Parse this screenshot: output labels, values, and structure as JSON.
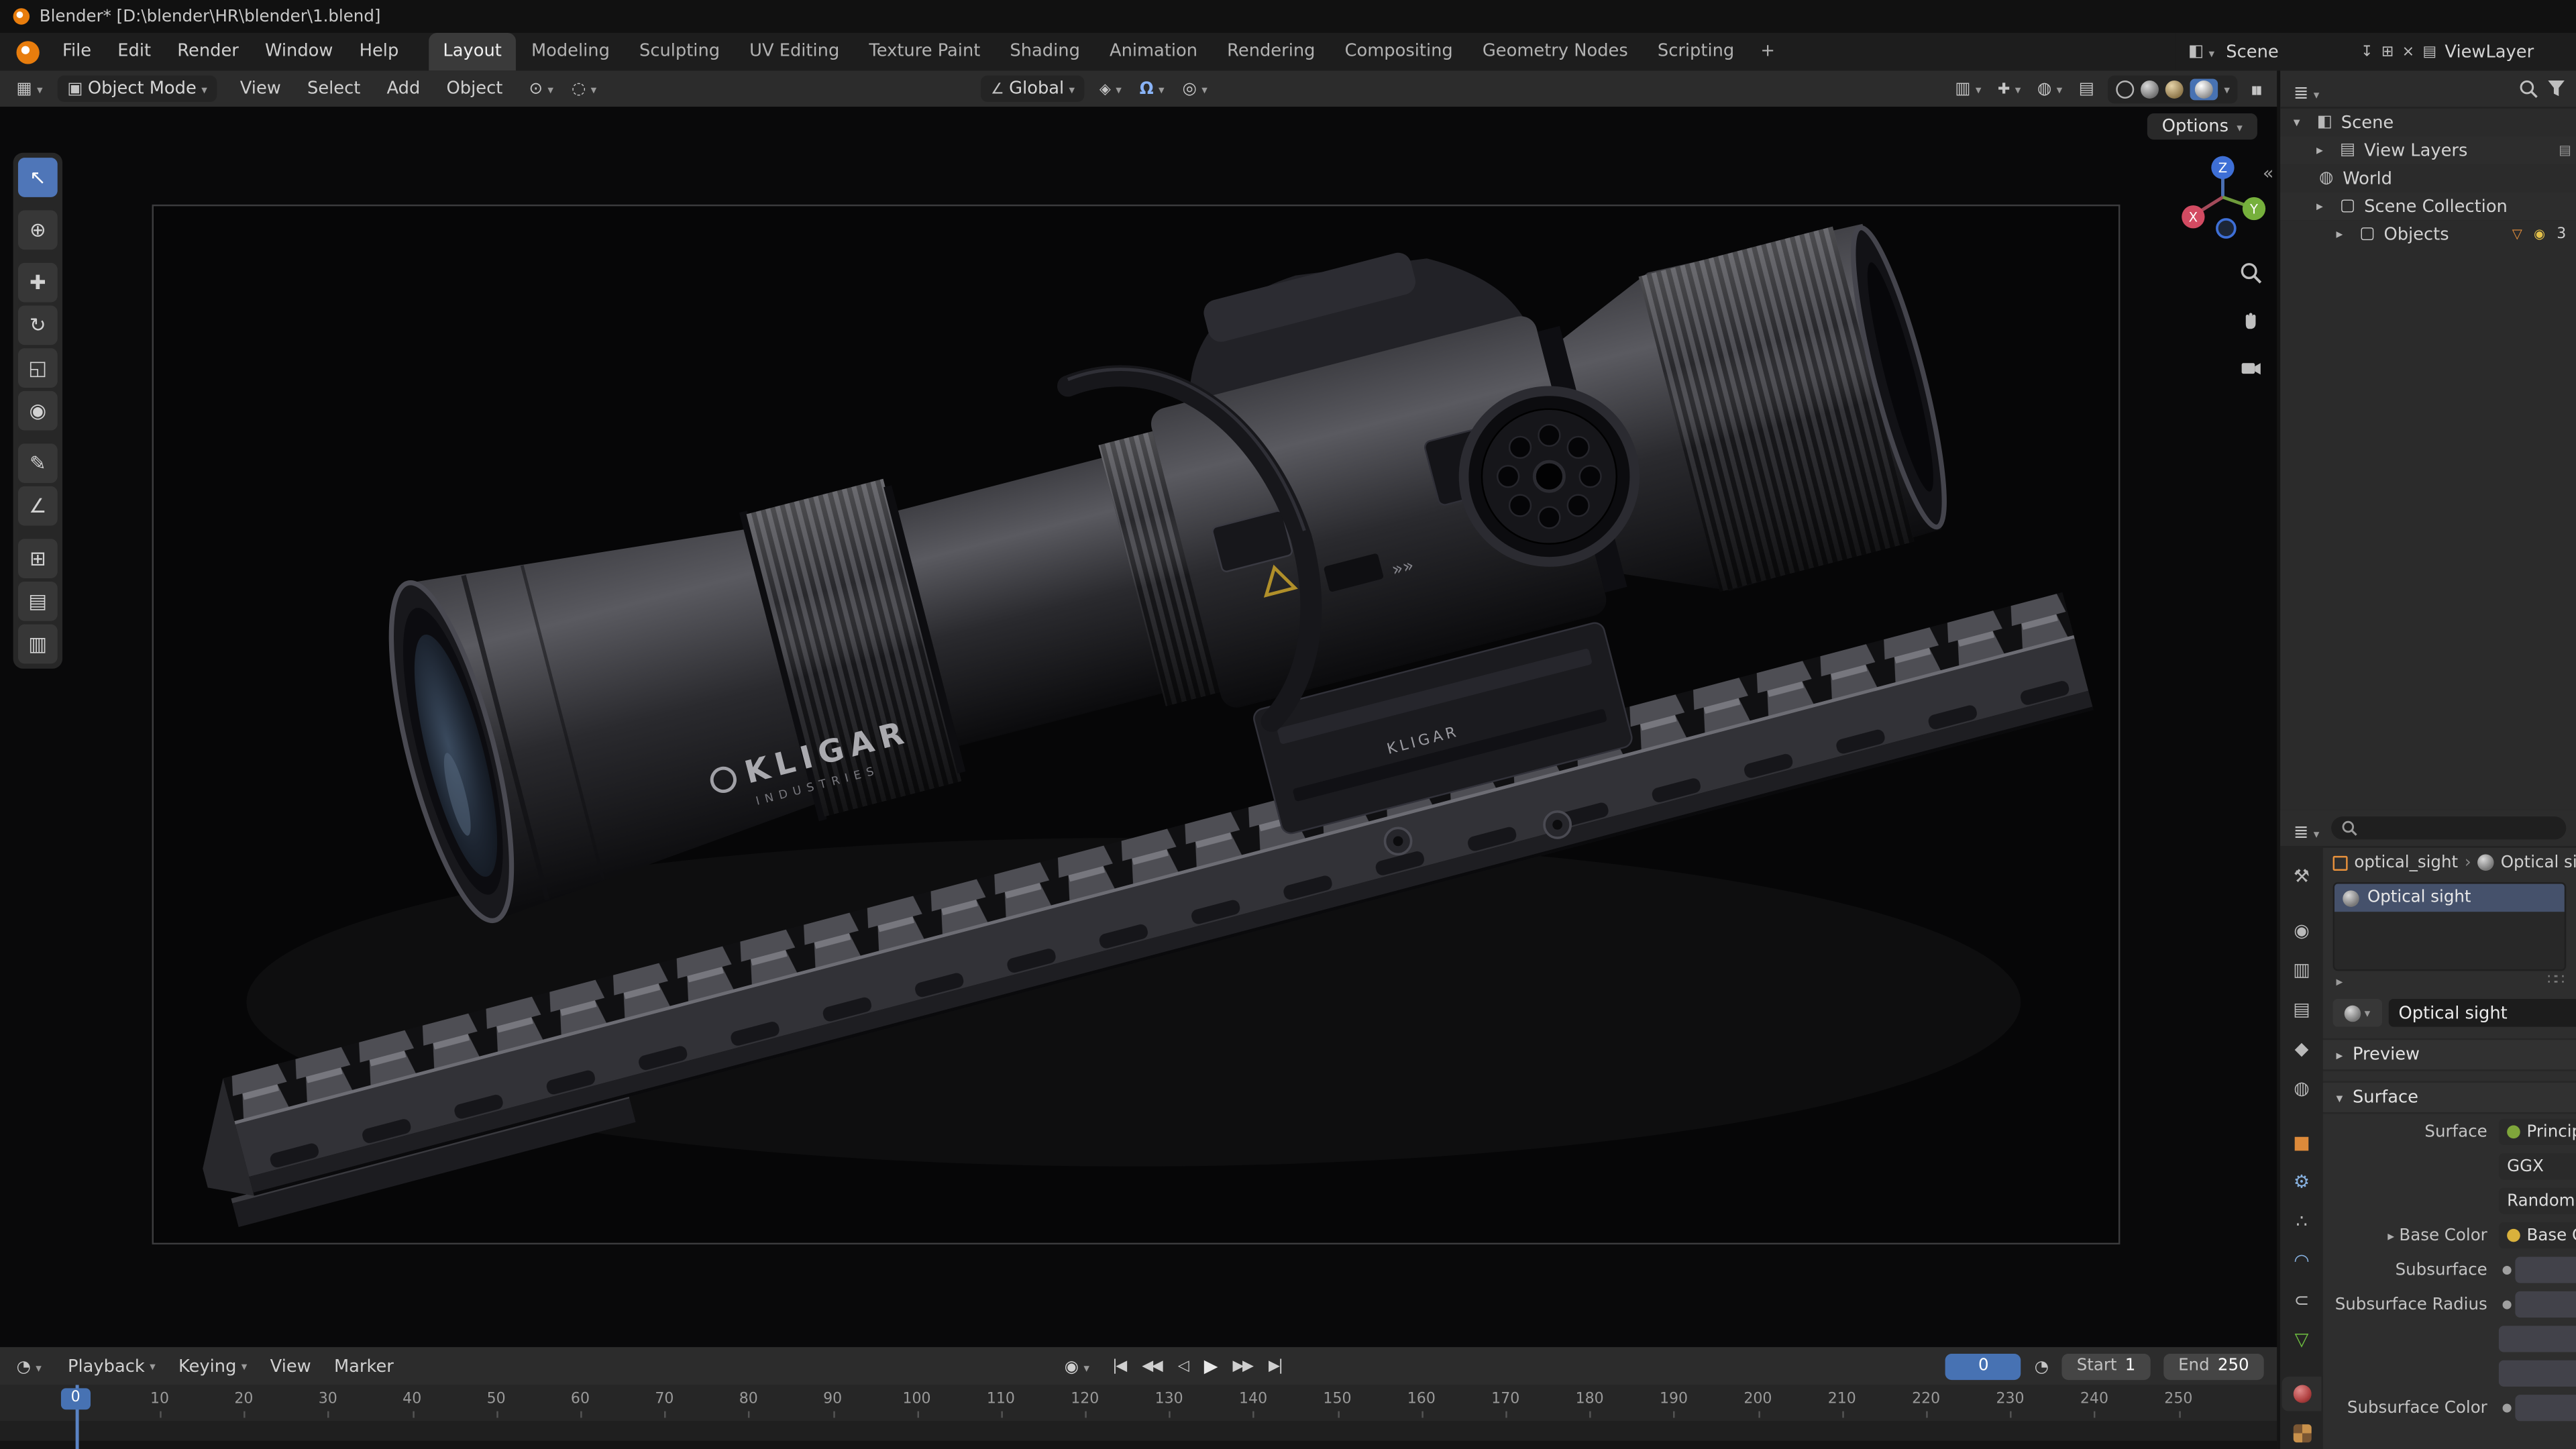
{
  "window": {
    "title": "Blender* [D:\\blender\\HR\\blender\\1.blend]"
  },
  "menubar": {
    "app_menus": [
      {
        "label": "File"
      },
      {
        "label": "Edit"
      },
      {
        "label": "Render"
      },
      {
        "label": "Window"
      },
      {
        "label": "Help"
      }
    ],
    "workspaces": [
      {
        "label": "Layout",
        "state": "active"
      },
      {
        "label": "Modeling"
      },
      {
        "label": "Sculpting"
      },
      {
        "label": "UV Editing"
      },
      {
        "label": "Texture Paint"
      },
      {
        "label": "Shading"
      },
      {
        "label": "Animation"
      },
      {
        "label": "Rendering"
      },
      {
        "label": "Compositing"
      },
      {
        "label": "Geometry Nodes"
      },
      {
        "label": "Scripting"
      }
    ],
    "add_workspace_label": "+",
    "scene_name": "Scene",
    "view_layer_name": "ViewLayer"
  },
  "viewport": {
    "header": {
      "mode": "Object Mode",
      "menus": [
        {
          "label": "View"
        },
        {
          "label": "Select"
        },
        {
          "label": "Add"
        },
        {
          "label": "Object"
        }
      ],
      "orientation": "Global",
      "options_label": "Options",
      "collapse_arrow": "«"
    },
    "toolbar": [
      {
        "dn": "tool-select-box",
        "glyph": "↖",
        "state": "active"
      },
      {
        "dn": "tool-cursor",
        "glyph": "⊕",
        "state": "gap"
      },
      {
        "dn": "tool-move",
        "glyph": "✚",
        "state": "gap"
      },
      {
        "dn": "tool-rotate",
        "glyph": "↻"
      },
      {
        "dn": "tool-scale",
        "glyph": "◱"
      },
      {
        "dn": "tool-transform",
        "glyph": "◉"
      },
      {
        "dn": "tool-annotate",
        "glyph": "✎",
        "state": "gap"
      },
      {
        "dn": "tool-measure",
        "glyph": "∠"
      },
      {
        "dn": "tool-add-cube",
        "glyph": "⊞",
        "state": "gap"
      },
      {
        "dn": "tool-extra-a",
        "glyph": "▤"
      },
      {
        "dn": "tool-extra-b",
        "glyph": "▥"
      }
    ],
    "model": {
      "brand": "KLIGAR",
      "brand_sub": "INDUSTRIES",
      "markings": "»»"
    }
  },
  "nav_gizmo": {
    "axes": [
      {
        "label": "Z",
        "color": "#3e6fd6"
      },
      {
        "label": "X",
        "color": "#d24b62"
      },
      {
        "label": "Y",
        "color": "#76b03c"
      }
    ]
  },
  "outliner": {
    "rows": [
      {
        "arrow": "▾",
        "icon_class": "ic-scene",
        "icon_name": "scene-icon",
        "label": "Scene",
        "ind": "ind0"
      },
      {
        "arrow": "▸",
        "icon_class": "ic-viewlayers",
        "icon_name": "view-layers-icon",
        "label": "View Layers",
        "ind": "ind1",
        "b0": "▤"
      },
      {
        "icon_class": "ic-world",
        "icon_name": "world-icon",
        "label": "World",
        "ind": "ind1"
      },
      {
        "arrow": "▸",
        "icon_class": "ic-collection",
        "icon_name": "collection-icon",
        "label": "Scene Collection",
        "ind": "ind1"
      },
      {
        "arrow": "▸",
        "icon_class": "ic-collection",
        "icon_name": "collection-icon",
        "label": "Objects",
        "ind": "ind2",
        "b1": "▽",
        "b2": "◉",
        "count": "3"
      }
    ]
  },
  "properties": {
    "breadcrumb": {
      "object_name": "optical_sight",
      "separator": "›",
      "material_name": "Optical sight"
    },
    "slots": [
      {
        "label": "Optical sight",
        "state": "selected"
      }
    ],
    "specials_arrow": "▸",
    "grip": "∷∷",
    "datablock_name": "Optical sight",
    "panels": {
      "preview": {
        "arrow": "▸",
        "label": "Preview"
      },
      "surface": {
        "arrow": "▾",
        "label": "Surface"
      }
    },
    "rows": [
      {
        "label": "Surface",
        "kind": "menu",
        "icon_style": "background:#7fa63b",
        "text": "Principled BSDF"
      },
      {
        "kind": "menu",
        "text": "GGX"
      },
      {
        "kind": "menu",
        "text": "Random Walk"
      },
      {
        "label": "Base Color",
        "arrow": "▸",
        "kind": "menu",
        "icon_style": "background:#d9b13c",
        "text": "Base Color"
      },
      {
        "label": "Subsurface",
        "kind": "value",
        "dot": "●"
      },
      {
        "label": "Subsurface Radius",
        "kind": "value",
        "dot": "●"
      },
      {
        "kind": "value"
      },
      {
        "kind": "value"
      },
      {
        "label": "Subsurface Color",
        "kind": "value",
        "dot": "●"
      }
    ],
    "tabs": [
      {
        "dn": "properties-tab-tool",
        "glyph": "⚒"
      },
      {
        "dn": "properties-tab-render",
        "glyph": "◉",
        "state": "gap"
      },
      {
        "dn": "properties-tab-output",
        "glyph": "▥"
      },
      {
        "dn": "properties-tab-view-layer",
        "glyph": "▤"
      },
      {
        "dn": "properties-tab-scene",
        "glyph": "◆"
      },
      {
        "dn": "properties-tab-world",
        "glyph": "◍"
      },
      {
        "dn": "properties-tab-object",
        "glyph": "■",
        "style": "color:#dd8a3a",
        "state": "gap"
      },
      {
        "dn": "properties-tab-modifiers",
        "glyph": "⚙",
        "style": "color:#87b1e0"
      },
      {
        "dn": "properties-tab-particles",
        "glyph": "∴"
      },
      {
        "dn": "properties-tab-physics",
        "glyph": "◠",
        "style": "color:#87b1e0"
      },
      {
        "dn": "properties-tab-constraints",
        "glyph": "⊂"
      },
      {
        "dn": "properties-tab-data",
        "glyph": "▽",
        "style": "color:#6fc040"
      },
      {
        "dn": "properties-tab-material",
        "cls": "sphere",
        "state": "active gap"
      },
      {
        "dn": "properties-tab-texture",
        "cls": "checker"
      }
    ]
  },
  "timeline": {
    "menus": [
      {
        "label": "Playback",
        "chev": "▾"
      },
      {
        "label": "Keying",
        "chev": "▾"
      },
      {
        "label": "View"
      },
      {
        "label": "Marker"
      }
    ],
    "transport": [
      {
        "dn": "jump-to-start-button",
        "glyph": "|◀"
      },
      {
        "dn": "prev-keyframe-button",
        "glyph": "◀◀"
      },
      {
        "dn": "play-reverse-button",
        "glyph": "◁"
      },
      {
        "dn": "play-button",
        "glyph": "▶",
        "cls": "play"
      },
      {
        "dn": "next-keyframe-button",
        "glyph": "▶▶"
      },
      {
        "dn": "jump-to-end-button",
        "glyph": "▶|"
      }
    ],
    "current_frame": "0",
    "start_label": "Start",
    "start_value": "1",
    "end_label": "End",
    "end_value": "250",
    "ruler_ticks": [
      10,
      20,
      30,
      40,
      50,
      60,
      70,
      80,
      90,
      100,
      110,
      120,
      130,
      140,
      150,
      160,
      170,
      180,
      190,
      200,
      210,
      220,
      230,
      240,
      250
    ]
  },
  "colors": {
    "accent_blue": "#4772b3",
    "object_orange": "#e8913c",
    "data_green": "#6fc040",
    "axis_x": "#d24b62",
    "axis_y": "#76b03c",
    "axis_z": "#3e6fd6"
  }
}
